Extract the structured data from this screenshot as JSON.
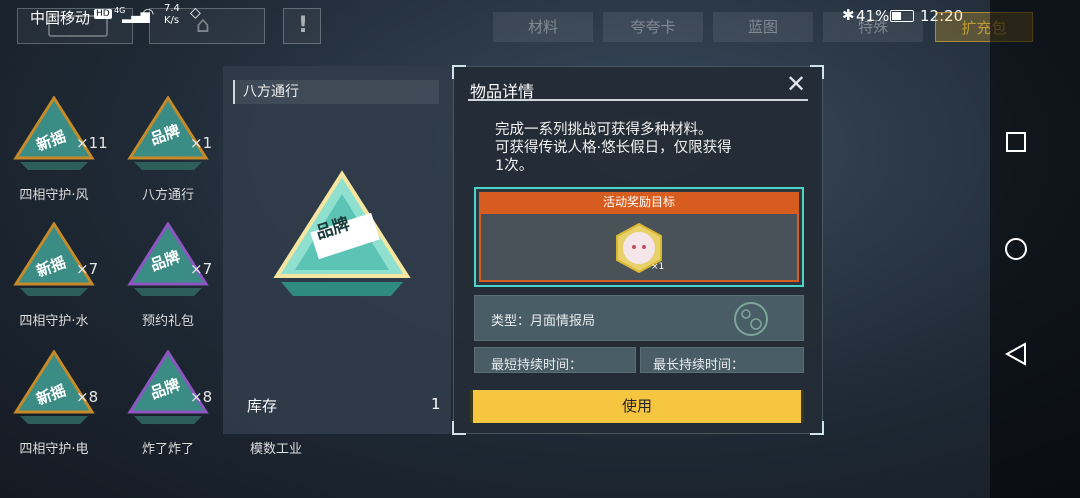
{
  "status_bar": {
    "carrier": "中国移动",
    "net_badge": "HD",
    "signal_type": "4G",
    "speed_value": "7.4",
    "speed_unit": "K/s",
    "battery": "41%",
    "time": "12:20"
  },
  "tabs": [
    {
      "label": "材料"
    },
    {
      "label": "夸夸卡"
    },
    {
      "label": "蓝图"
    },
    {
      "label": "特殊"
    },
    {
      "label": "扩充包"
    }
  ],
  "inventory": [
    {
      "label": "四相守护·风",
      "count": "×11",
      "badge": "新摇",
      "color": "#c58a2a"
    },
    {
      "label": "八方通行",
      "count": "×1",
      "badge": "品牌",
      "color": "#c58a2a"
    },
    {
      "label": "四相守护·水",
      "count": "×7",
      "badge": "新摇",
      "color": "#c58a2a"
    },
    {
      "label": "预约礼包",
      "count": "×7",
      "badge": "品牌",
      "color": "#8b56c0"
    },
    {
      "label": "四相守护·电",
      "count": "×8",
      "badge": "新摇",
      "color": "#c58a2a"
    },
    {
      "label": "炸了炸了",
      "count": "×8",
      "badge": "品牌",
      "color": "#8b56c0"
    }
  ],
  "left_panel": {
    "title": "八方通行",
    "badge": "品牌",
    "stock_label": "库存",
    "stock_value": "1",
    "below_label": "模数工业"
  },
  "detail": {
    "title": "物品详情",
    "description_lines": [
      "完成一系列挑战可获得多种材料。",
      "可获得传说人格·悠长假日，仅限获得",
      "1次。"
    ],
    "reward_header": "活动奖励目标",
    "reward_count": "×1",
    "type_text": "类型：月面情报局",
    "min_duration_label": "最短持续时间：",
    "max_duration_label": "最长持续时间：",
    "use_button": "使用"
  },
  "colors": {
    "accent_orange": "#d65d1f",
    "accent_teal": "#4ed4c8",
    "use_yellow": "#f6c640"
  }
}
